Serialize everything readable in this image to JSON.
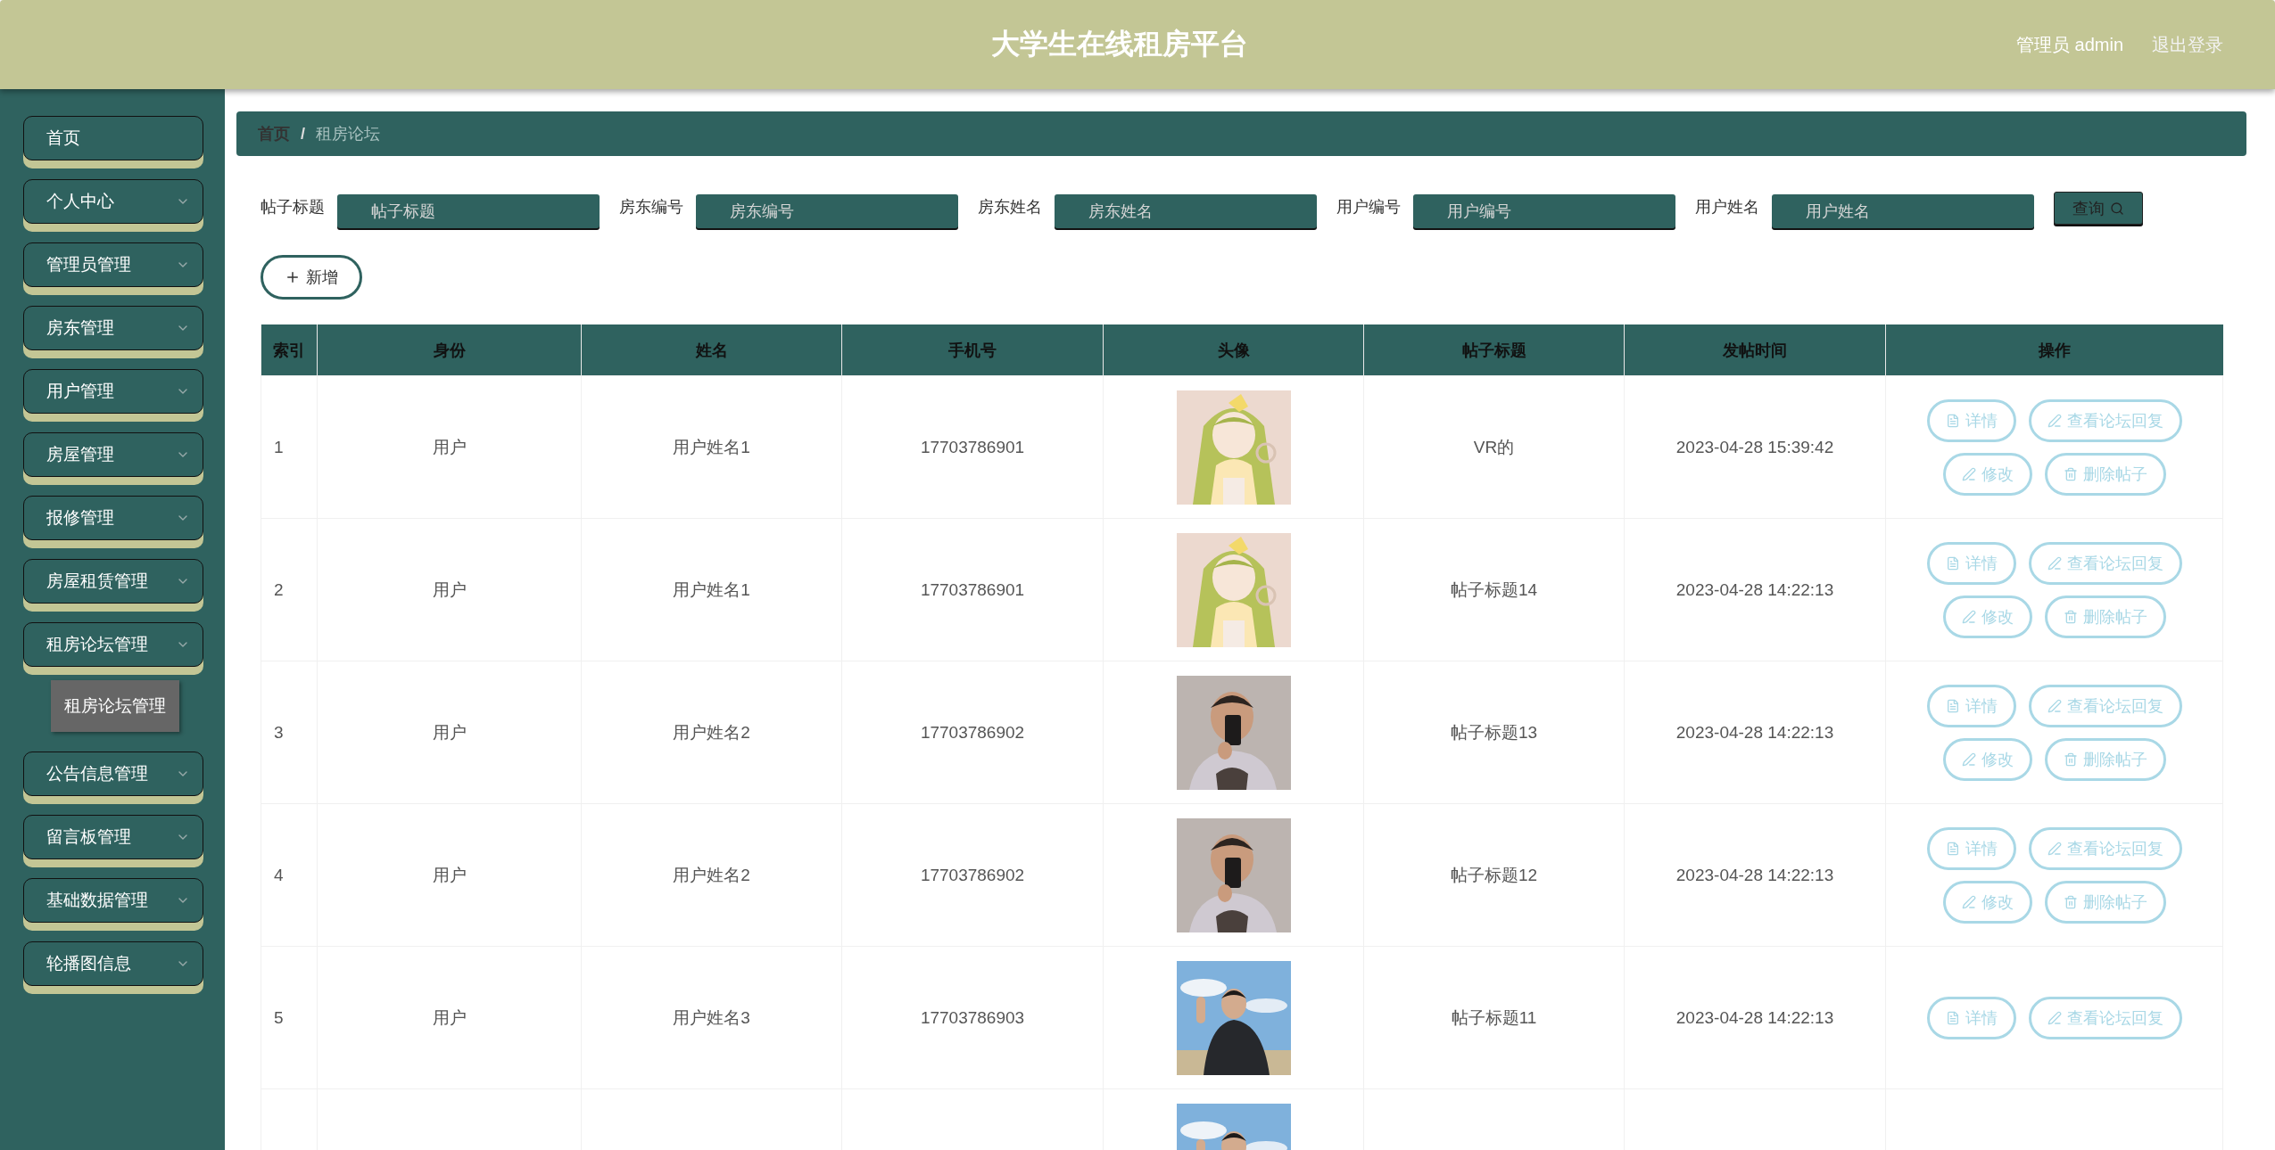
{
  "header": {
    "title": "大学生在线租房平台",
    "user": "管理员 admin",
    "logout": "退出登录"
  },
  "sidebar": {
    "items": [
      {
        "label": "首页",
        "kind": "link"
      },
      {
        "label": "个人中心",
        "kind": "menu"
      },
      {
        "label": "管理员管理",
        "kind": "menu"
      },
      {
        "label": "房东管理",
        "kind": "menu"
      },
      {
        "label": "用户管理",
        "kind": "menu"
      },
      {
        "label": "房屋管理",
        "kind": "menu"
      },
      {
        "label": "报修管理",
        "kind": "menu"
      },
      {
        "label": "房屋租赁管理",
        "kind": "menu"
      },
      {
        "label": "租房论坛管理",
        "kind": "menu",
        "children": [
          {
            "label": "租房论坛管理",
            "selected": true
          }
        ]
      },
      {
        "label": "公告信息管理",
        "kind": "menu"
      },
      {
        "label": "留言板管理",
        "kind": "menu"
      },
      {
        "label": "基础数据管理",
        "kind": "menu"
      },
      {
        "label": "轮播图信息",
        "kind": "menu"
      }
    ]
  },
  "breadcrumb": [
    "首页",
    "租房论坛"
  ],
  "breadcrumb_separator": "/",
  "search": {
    "fields": [
      {
        "label": "帖子标题",
        "placeholder": "帖子标题"
      },
      {
        "label": "房东编号",
        "placeholder": "房东编号"
      },
      {
        "label": "房东姓名",
        "placeholder": "房东姓名"
      },
      {
        "label": "用户编号",
        "placeholder": "用户编号"
      },
      {
        "label": "用户姓名",
        "placeholder": "用户姓名"
      }
    ],
    "button": "查询"
  },
  "add_button": "新增",
  "table": {
    "columns": [
      "索引",
      "身份",
      "姓名",
      "手机号",
      "头像",
      "帖子标题",
      "发帖时间",
      "操作"
    ],
    "rows": [
      {
        "index": "1",
        "identity": "用户",
        "name": "用户姓名1",
        "phone": "17703786901",
        "avatar": {
          "kind": "picture"
        },
        "title": "VR的",
        "time": "2023-04-28 15:39:42",
        "actions": [
          {
            "kind": "detail",
            "label": "详情"
          },
          {
            "kind": "replies",
            "label": "查看论坛回复"
          },
          {
            "kind": "edit",
            "label": "修改"
          },
          {
            "kind": "delete",
            "label": "删除帖子"
          }
        ]
      },
      {
        "index": "2",
        "identity": "用户",
        "name": "用户姓名1",
        "phone": "17703786901",
        "avatar": {
          "kind": "picture"
        },
        "title": "帖子标题14",
        "time": "2023-04-28 14:22:13",
        "actions": [
          {
            "kind": "detail",
            "label": "详情"
          },
          {
            "kind": "replies",
            "label": "查看论坛回复"
          },
          {
            "kind": "edit",
            "label": "修改"
          },
          {
            "kind": "delete",
            "label": "删除帖子"
          }
        ]
      },
      {
        "index": "3",
        "identity": "用户",
        "name": "用户姓名2",
        "phone": "17703786902",
        "avatar": {
          "kind": "picture"
        },
        "title": "帖子标题13",
        "time": "2023-04-28 14:22:13",
        "actions": [
          {
            "kind": "detail",
            "label": "详情"
          },
          {
            "kind": "replies",
            "label": "查看论坛回复"
          },
          {
            "kind": "edit",
            "label": "修改"
          },
          {
            "kind": "delete",
            "label": "删除帖子"
          }
        ]
      },
      {
        "index": "4",
        "identity": "用户",
        "name": "用户姓名2",
        "phone": "17703786902",
        "avatar": {
          "kind": "picture"
        },
        "title": "帖子标题12",
        "time": "2023-04-28 14:22:13",
        "actions": [
          {
            "kind": "detail",
            "label": "详情"
          },
          {
            "kind": "replies",
            "label": "查看论坛回复"
          },
          {
            "kind": "edit",
            "label": "修改"
          },
          {
            "kind": "delete",
            "label": "删除帖子"
          }
        ]
      },
      {
        "index": "5",
        "identity": "用户",
        "name": "用户姓名3",
        "phone": "17703786903",
        "avatar": {
          "kind": "picture"
        },
        "title": "帖子标题11",
        "time": "2023-04-28 14:22:13",
        "actions": [
          {
            "kind": "detail",
            "label": "详情"
          },
          {
            "kind": "replies",
            "label": "查看论坛回复"
          }
        ]
      },
      {
        "avatar": {
          "kind": "picture"
        }
      }
    ]
  }
}
